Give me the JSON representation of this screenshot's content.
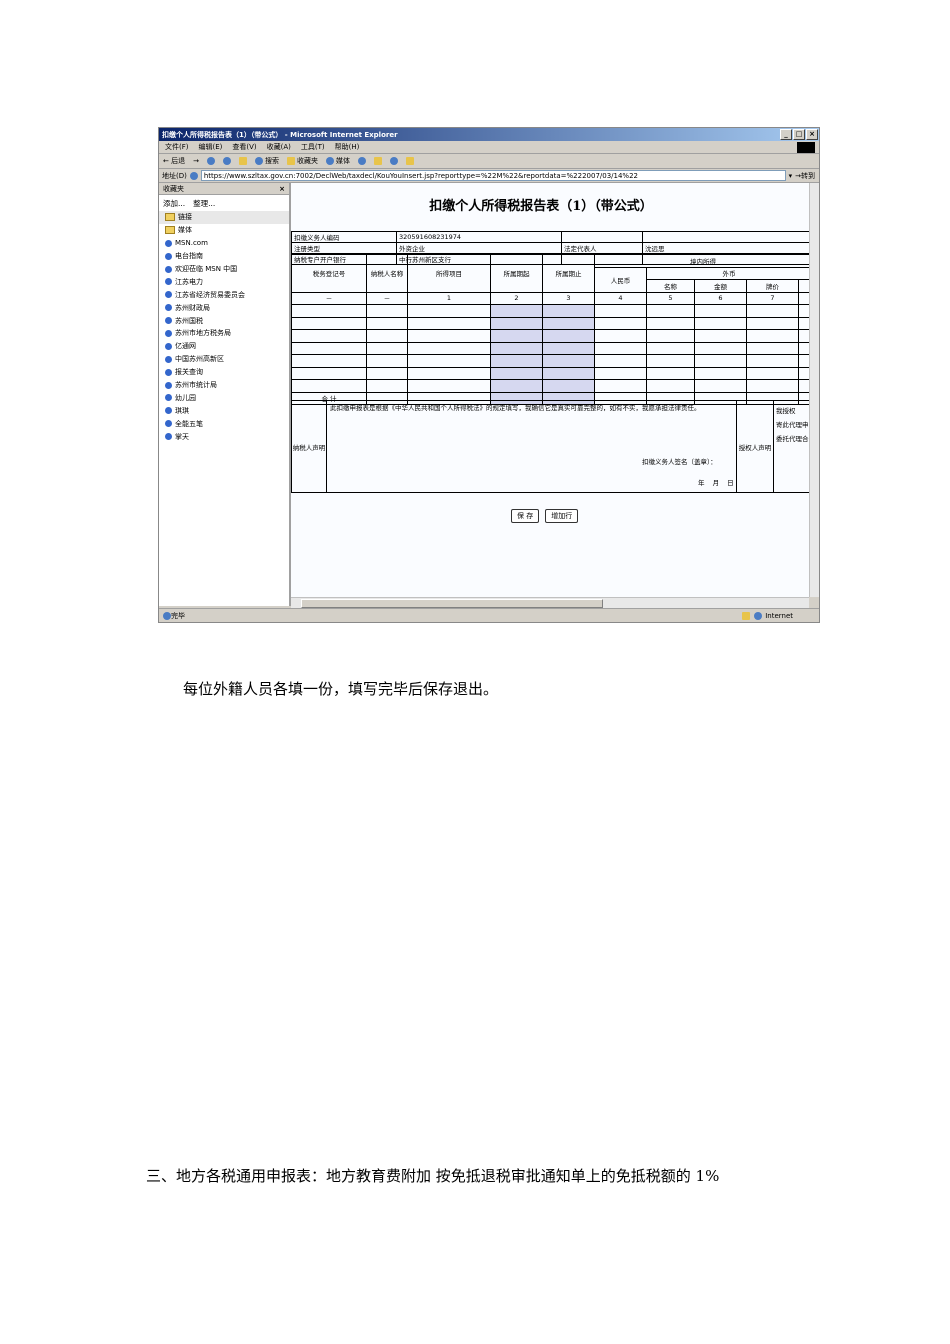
{
  "window": {
    "title": "扣缴个人所得税报告表（1）（带公式） - Microsoft Internet Explorer",
    "buttons": [
      "_",
      "□",
      "×"
    ]
  },
  "menu": [
    "文件(F)",
    "编辑(E)",
    "查看(V)",
    "收藏(A)",
    "工具(T)",
    "帮助(H)"
  ],
  "toolbar": {
    "back": "← 后退",
    "forward": "→",
    "search": "搜索",
    "favorites": "收藏夹",
    "media": "媒体"
  },
  "address": {
    "label": "地址(D)",
    "url": "https://www.szltax.gov.cn:7002/DeclWeb/taxdecl/KouYouInsert.jsp?reporttype=%22M%22&reportdata=%222007/03/14%22",
    "go": "转到"
  },
  "sidebar": {
    "title": "收藏夹",
    "close": "×",
    "add": "添加...",
    "organize": "整理...",
    "items": [
      "链接",
      "媒体",
      "MSN.com",
      "电台指南",
      "欢迎莅临 MSN 中国",
      "江苏电力",
      "江苏省经济贸易委员会",
      "苏州财政局",
      "苏州国税",
      "苏州市地方税务局",
      "亿通网",
      "中国苏州高新区",
      "报关查询",
      "苏州市统计局",
      "幼儿园",
      "琪琪",
      "全能五笔",
      "掌天"
    ]
  },
  "form": {
    "title": "扣缴个人所得税报告表（1）（带公式）",
    "meta": [
      [
        "扣缴义务人编码",
        "320591608231974",
        "",
        ""
      ],
      [
        "注册类型",
        "外资企业",
        "法定代表人",
        "沈远思"
      ],
      [
        "纳税专户开户银行",
        "中行苏州新区支行",
        "",
        ""
      ]
    ],
    "headers": {
      "reg_no": "税务登记号",
      "name": "纳税人名称",
      "item": "所得项目",
      "start": "所属期起",
      "end": "所属期止",
      "domestic": "境内所得",
      "rmb": "人民币",
      "foreign": "外币",
      "fx_name": "名称",
      "fx_amount": "金额",
      "fx_rate": "牌价"
    },
    "col_index": [
      "－",
      "－",
      "1",
      "2",
      "3",
      "4",
      "5",
      "6",
      "7"
    ],
    "total_label": "合  计",
    "declaration": {
      "label": "纳税人声明",
      "text": "此扣缴申报表是根据《中华人民共和国个人所得税法》的规定填写，我确信它是真实可靠完整的，如有不实，我愿承担法律责任。",
      "signature": "扣缴义务人签名（盖章）：",
      "date": "年  月  日",
      "auth_label": "授权人声明",
      "auth_text_1": "我授权",
      "auth_text_2": "寄此代理申",
      "auth_text_3": "委托代理合"
    },
    "buttons": {
      "save": "保 存",
      "add_row": "增加行"
    }
  },
  "status": {
    "text": "完毕",
    "zone": "Internet"
  },
  "paragraphs": {
    "p1": "每位外籍人员各填一份，填写完毕后保存退出。",
    "p2": "三、地方各税通用申报表：地方教育费附加   按免抵退税审批通知单上的免抵税额的 1%"
  }
}
